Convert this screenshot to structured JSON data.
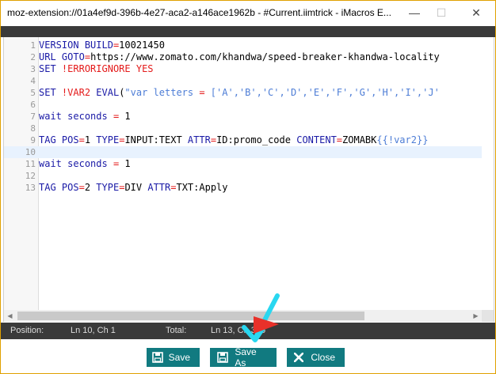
{
  "window": {
    "title": "moz-extension://01a4ef9d-396b-4e27-aca2-a146ace1962b - #Current.iimtrick - iMacros E...",
    "minimize_symbol": "—",
    "maximize_symbol": "☐",
    "close_symbol": "✕"
  },
  "editor": {
    "lines": [
      {
        "num": "1",
        "text": "VERSION BUILD=10021450"
      },
      {
        "num": "2",
        "text": "URL GOTO=https://www.zomato.com/khandwa/speed-breaker-khandwa-locality"
      },
      {
        "num": "3",
        "text": "SET !ERRORIGNORE YES"
      },
      {
        "num": "4",
        "text": ""
      },
      {
        "num": "5",
        "text": "SET !VAR2 EVAL(\"var letters = ['A','B','C','D','E','F','G','H','I','J'"
      },
      {
        "num": "6",
        "text": ""
      },
      {
        "num": "7",
        "text": "wait seconds = 1"
      },
      {
        "num": "8",
        "text": ""
      },
      {
        "num": "9",
        "text": "TAG POS=1 TYPE=INPUT:TEXT ATTR=ID:promo_code CONTENT=ZOMABK{{!var2}}"
      },
      {
        "num": "10",
        "text": ""
      },
      {
        "num": "11",
        "text": "wait seconds = 1"
      },
      {
        "num": "12",
        "text": ""
      },
      {
        "num": "13",
        "text": "TAG POS=2 TYPE=DIV ATTR=TXT:Apply"
      }
    ],
    "active_line": "10"
  },
  "status": {
    "position_label": "Position:",
    "position_value": "Ln 10, Ch 1",
    "total_label": "Total:",
    "total_value": "Ln 13, Ch 356"
  },
  "buttons": {
    "save": "Save",
    "save_as": "Save As",
    "close": "Close"
  },
  "colors": {
    "button_bg": "#117a80",
    "status_bar": "#3a3a3a",
    "active_line": "#e8f2fe",
    "annotation_arrow": "#29d7f0",
    "annotation_triangle": "#e8312a"
  }
}
